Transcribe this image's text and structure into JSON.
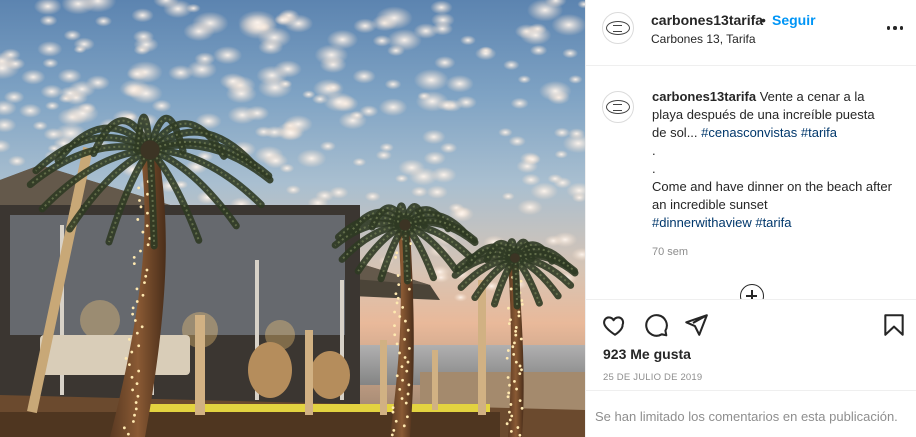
{
  "post": {
    "username": "carbones13tarifa",
    "separator": "•",
    "follow_label": "Seguir",
    "location": "Carbones 13, Tarifa",
    "more_icon": "more-options-icon"
  },
  "avatar": {
    "logo_text": "CARBONES 13 TARIFA"
  },
  "caption": {
    "username": "carbones13tarifa",
    "text_es": "Vente a cenar a la playa después de una increíble puesta de sol...",
    "tags_es": "#cenasconvistas #tarifa",
    "dot1": ".",
    "dot2": ".",
    "text_en": "Come and have dinner on the beach after an incredible sunset",
    "tags_en": "#dinnerwithaview #tarifa",
    "time": "70 sem"
  },
  "actions": {
    "like_icon": "heart-icon",
    "comment_icon": "comment-icon",
    "share_icon": "paper-plane-icon",
    "save_icon": "bookmark-icon",
    "likes": "923 Me gusta",
    "date": "25 DE JULIO DE 2019",
    "comments_limited": "Se han limitado los comentarios en esta publicación."
  },
  "colors": {
    "link_blue": "#0095f6",
    "hashtag": "#00376b",
    "muted": "#8e8e8e",
    "text": "#262626"
  }
}
